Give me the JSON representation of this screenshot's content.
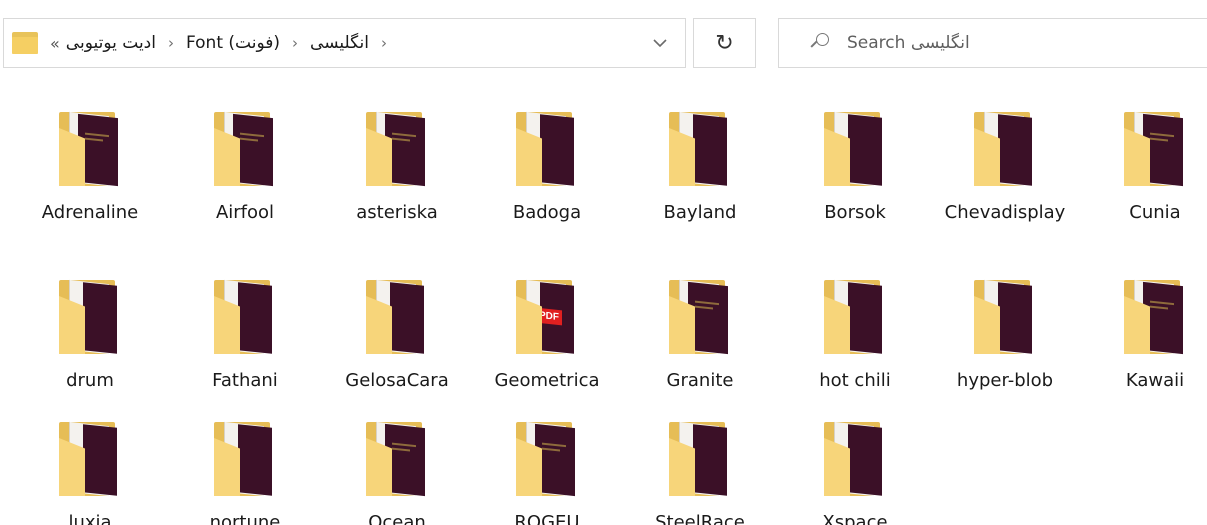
{
  "addressbar": {
    "overflow": "«",
    "crumbs": [
      "ادیت یوتیوبی",
      "Font (فونت)",
      "انگلیسی"
    ],
    "separator": "›",
    "dropdown_glyph": "⌵"
  },
  "refresh": {
    "glyph": "↻"
  },
  "search": {
    "placeholder": "Search انگلیسی"
  },
  "folders": [
    {
      "name": "Adrenaline",
      "preview": "dark"
    },
    {
      "name": "Airfool",
      "preview": "dark"
    },
    {
      "name": "asteriska",
      "preview": "dark"
    },
    {
      "name": "Badoga",
      "preview": "light"
    },
    {
      "name": "Bayland",
      "preview": "light"
    },
    {
      "name": "Borsok",
      "preview": "light"
    },
    {
      "name": "Chevadisplay",
      "preview": "light"
    },
    {
      "name": "Cunia",
      "preview": "dark"
    },
    {
      "name": "drum",
      "preview": "light"
    },
    {
      "name": "Fathani",
      "preview": "light"
    },
    {
      "name": "GelosaCara",
      "preview": "light"
    },
    {
      "name": "Geometrica",
      "preview": "pdf"
    },
    {
      "name": "Granite",
      "preview": "dark"
    },
    {
      "name": "hot chili",
      "preview": "light"
    },
    {
      "name": "hyper-blob",
      "preview": "light"
    },
    {
      "name": "Kawaii",
      "preview": "dark"
    },
    {
      "name": "luxia",
      "preview": "light"
    },
    {
      "name": "nortune",
      "preview": "light"
    },
    {
      "name": "Ocean",
      "preview": "dark"
    },
    {
      "name": "ROGEU",
      "preview": "dark"
    },
    {
      "name": "SteelRace",
      "preview": "light"
    },
    {
      "name": "Xspace",
      "preview": "light"
    }
  ]
}
